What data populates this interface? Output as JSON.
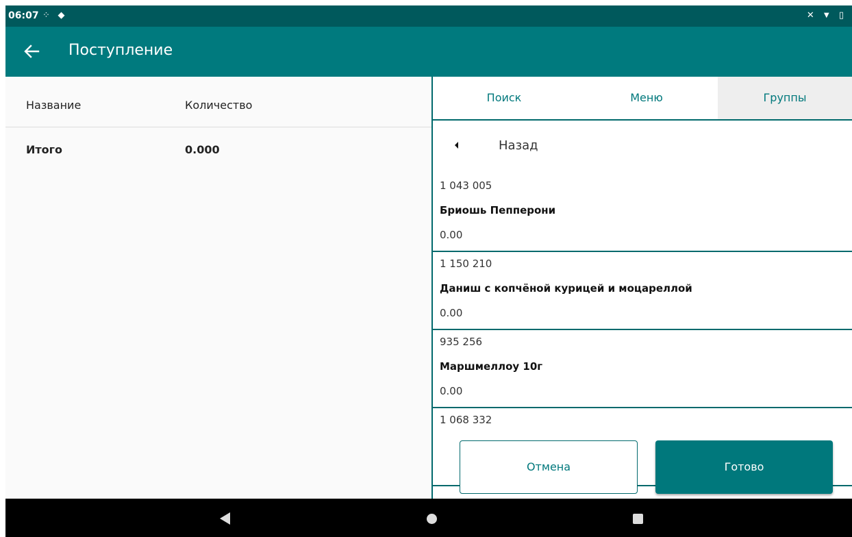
{
  "status_bar": {
    "time": "06:07",
    "left_icons": [
      "notification-icon",
      "data-arrows-icon"
    ],
    "right_icons": [
      "muted-icon",
      "wifi-icon",
      "battery-icon"
    ]
  },
  "app_bar": {
    "title": "Поступление",
    "back_icon": "arrow-left-icon"
  },
  "left_table": {
    "columns": [
      "Название",
      "Количество"
    ],
    "total_label": "Итого",
    "total_value": "0.000"
  },
  "tabs": [
    {
      "label": "Поиск"
    },
    {
      "label": "Меню"
    },
    {
      "label": "Группы",
      "selected": true
    }
  ],
  "back_row": {
    "label": "Назад"
  },
  "items": [
    {
      "code": "1 043 005",
      "name": "Бриошь Пепперони",
      "price": "0.00"
    },
    {
      "code": "1 150 210",
      "name": "Даниш с копчёной курицей и моцареллой",
      "price": "0.00"
    },
    {
      "code": "935 256",
      "name": "Маршмеллоу 10г",
      "price": "0.00"
    },
    {
      "code": "1 068 332",
      "name": "",
      "price": ""
    }
  ],
  "buttons": {
    "cancel": "Отмена",
    "done": "Готово"
  },
  "colors": {
    "status_bar": "#00595c",
    "app_bar": "#007a7e",
    "accent": "#00787c"
  },
  "nav_bar": {
    "icons": [
      "nav-back-icon",
      "nav-home-icon",
      "nav-recents-icon"
    ]
  }
}
